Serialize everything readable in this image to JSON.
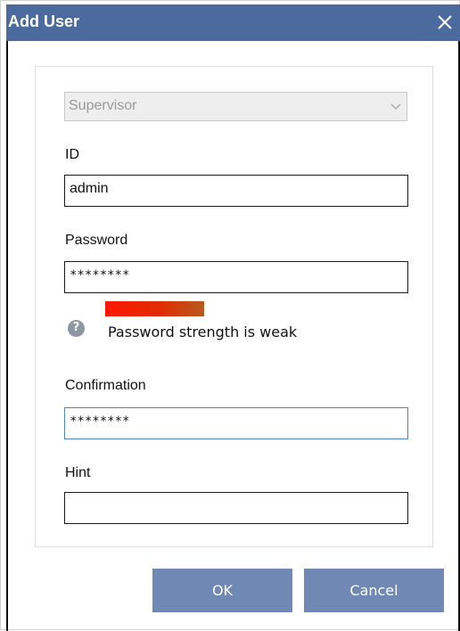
{
  "window": {
    "title": "Add User",
    "close_glyph": "close-icon"
  },
  "form": {
    "role_select": {
      "value": "Supervisor",
      "disabled": true
    },
    "id": {
      "label": "ID",
      "value": "admin"
    },
    "password": {
      "label": "Password",
      "value": "********"
    },
    "strength": {
      "message": "Password strength is weak",
      "level": "weak",
      "icon": "help-icon"
    },
    "confirmation": {
      "label": "Confirmation",
      "value": "********"
    },
    "hint": {
      "label": "Hint",
      "value": ""
    }
  },
  "buttons": {
    "ok_label": "OK",
    "cancel_label": "Cancel"
  },
  "colors": {
    "titlebar": "#4b6b9f",
    "button": "#7088b4",
    "focus_border": "#4a88b8",
    "strength_weak": "#ff1800"
  }
}
